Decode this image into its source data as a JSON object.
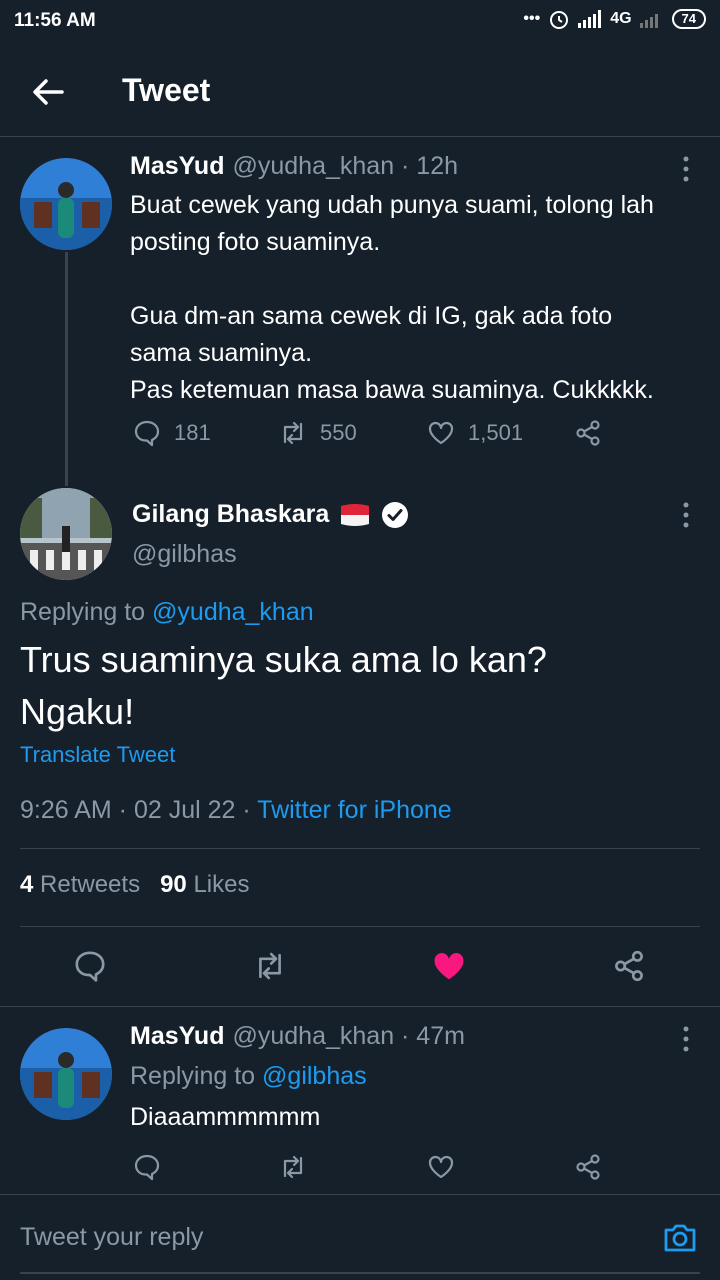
{
  "status_bar": {
    "time": "11:56 AM",
    "network": "4G",
    "battery": "74"
  },
  "header": {
    "title": "Tweet"
  },
  "parent_tweet": {
    "name": "MasYud",
    "handle": "@yudha_khan · 12h",
    "text": "Buat cewek yang udah punya suami, tolong lah\nposting foto suaminya.\n\nGua dm-an sama cewek di IG, gak ada foto\nsama suaminya.\nPas ketemuan masa bawa suaminya. Cukkkkk.",
    "replies": "181",
    "retweets": "550",
    "likes": "1,501"
  },
  "main_tweet": {
    "name": "Gilang Bhaskara",
    "handle": "@gilbhas",
    "replying_prefix": "Replying to ",
    "replying_handle": "@yudha_khan",
    "text": "Trus suaminya suka ama lo kan?\nNgaku!",
    "translate": "Translate Tweet",
    "timestamp": "9:26 AM · 02 Jul 22 · ",
    "source": "Twitter for iPhone",
    "retweet_count": "4",
    "retweet_label": "Retweets",
    "like_count": "90",
    "like_label": "Likes",
    "liked_color": "#f91880"
  },
  "reply_tweet": {
    "name": "MasYud",
    "handle": "@yudha_khan · 47m",
    "replying_prefix": "Replying to ",
    "replying_handle": "@gilbhas",
    "text": "Diaaammmmmm"
  },
  "composer": {
    "placeholder": "Tweet your reply"
  },
  "colors": {
    "background": "#15202b",
    "accent": "#1d9bf0",
    "muted": "#8b98a5",
    "divider": "#38444d"
  }
}
